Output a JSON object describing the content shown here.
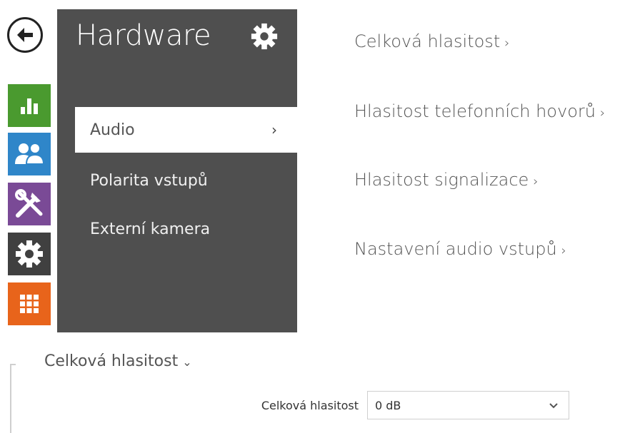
{
  "sidebar_panel": {
    "title": "Hardware",
    "items": [
      {
        "label": "Audio",
        "chevron": "›",
        "active": true
      },
      {
        "label": "Polarita vstupů"
      },
      {
        "label": "Externí kamera"
      }
    ]
  },
  "modules": [
    {
      "name": "status",
      "icon": "bar-chart-icon",
      "color": "#4a9a2f"
    },
    {
      "name": "directory",
      "icon": "users-icon",
      "color": "#2f86c9"
    },
    {
      "name": "services",
      "icon": "tools-icon",
      "color": "#7a4a96"
    },
    {
      "name": "hardware",
      "icon": "gear-icon",
      "color": "#404040"
    },
    {
      "name": "system",
      "icon": "grid-icon",
      "color": "#e8641b"
    }
  ],
  "links": [
    {
      "label": "Celková hlasitost",
      "arrow": "›"
    },
    {
      "label": "Hlasitost telefonních hovorů",
      "arrow": "›"
    },
    {
      "label": "Hlasitost signalizace",
      "arrow": "›"
    },
    {
      "label": "Nastavení audio vstupů",
      "arrow": "›"
    }
  ],
  "section": {
    "title": "Celková hlasitost",
    "arrow": "⌄",
    "field_label": "Celková hlasitost",
    "field_value": "0 dB"
  }
}
